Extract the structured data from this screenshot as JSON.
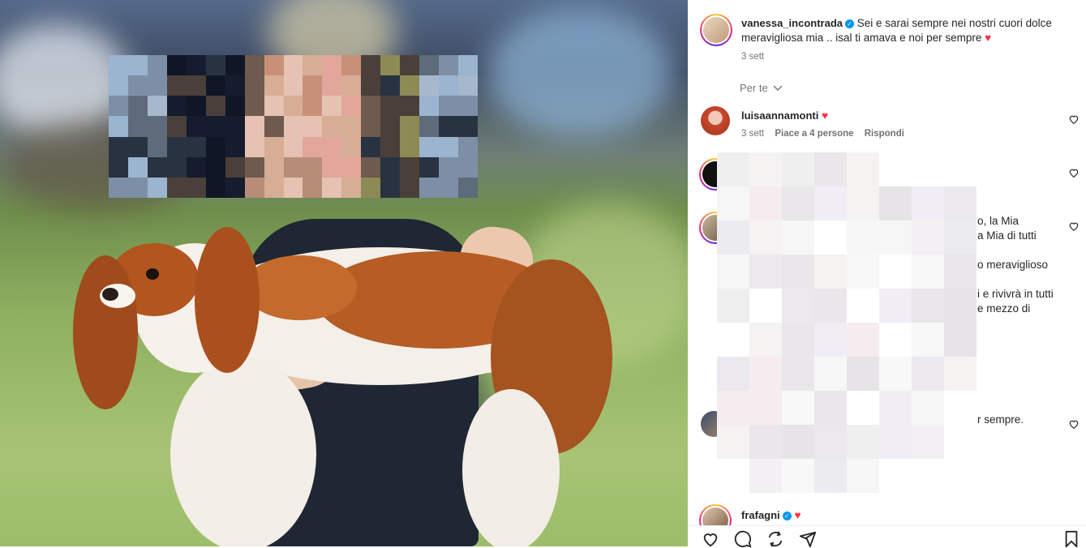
{
  "post": {
    "username": "vanessa_incontrada",
    "caption": "Sei e sarai sempre nei nostri cuori dolce meravigliosa mia .. isal ti amava e noi per sempre",
    "time": "3 sett"
  },
  "filter": {
    "label": "Per te"
  },
  "comments": [
    {
      "username": "luisaannamonti",
      "text": "",
      "time": "3 sett",
      "likes": "Piace a 4 persone",
      "reply": "Rispondi"
    },
    {
      "username": "",
      "text": ""
    },
    {
      "username": "",
      "text_fragments": [
        "o, la Mia",
        "a Mia di tutti",
        "o meraviglioso",
        "i e rivivrà in tutti",
        "e mezzo di"
      ]
    },
    {
      "username": "",
      "text_fragments": [
        "r sempre."
      ]
    },
    {
      "username": "frafagni",
      "text": ""
    }
  ],
  "colors": {
    "heart": "#ff3040",
    "verified": "#0095f6",
    "muted": "#737373",
    "text": "#262626"
  },
  "icons": [
    "heart-icon",
    "comment-icon",
    "repost-icon",
    "share-icon",
    "bookmark-icon",
    "like-icon",
    "chevron-down-icon",
    "verified-icon"
  ]
}
